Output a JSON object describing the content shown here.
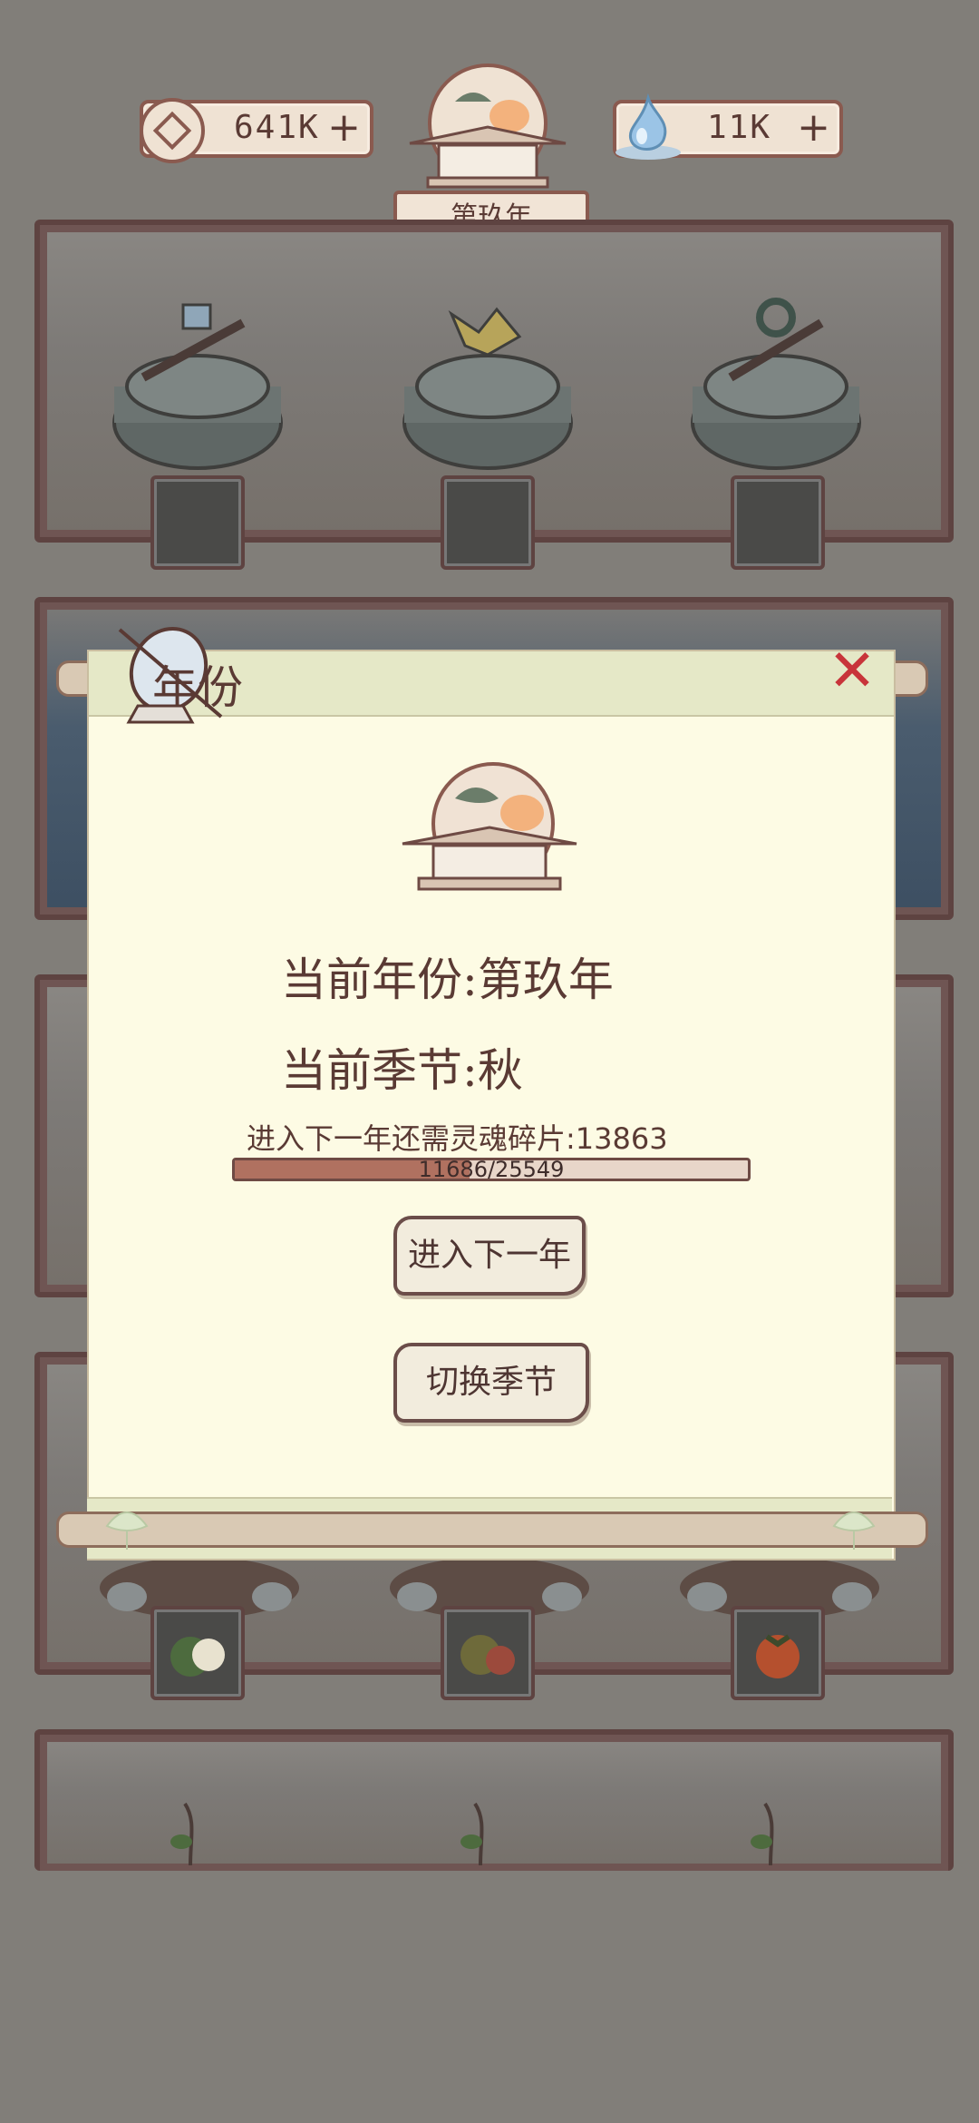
{
  "hud": {
    "coins": "641K",
    "coins_plus": "+",
    "spirit": "11K",
    "spirit_plus": "+",
    "year_badge": "第玖年"
  },
  "dialog": {
    "title": "年份",
    "current_year_label": "当前年份:",
    "current_year_value": "第玖年",
    "current_season_label": "当前季节:",
    "current_season_value": "秋",
    "requirement_label": "进入下一年还需灵魂碎片:",
    "requirement_value": "13863",
    "progress_text": "11686/25549",
    "progress_fraction": 0.4574,
    "next_year_button": "进入下一年",
    "switch_season_button": "切换季节",
    "close_icon": "close-x-icon"
  },
  "colors": {
    "background": "#817e79",
    "panel": "#fdfbe4",
    "accent_red": "#c8343a",
    "text": "#5a3a34"
  }
}
